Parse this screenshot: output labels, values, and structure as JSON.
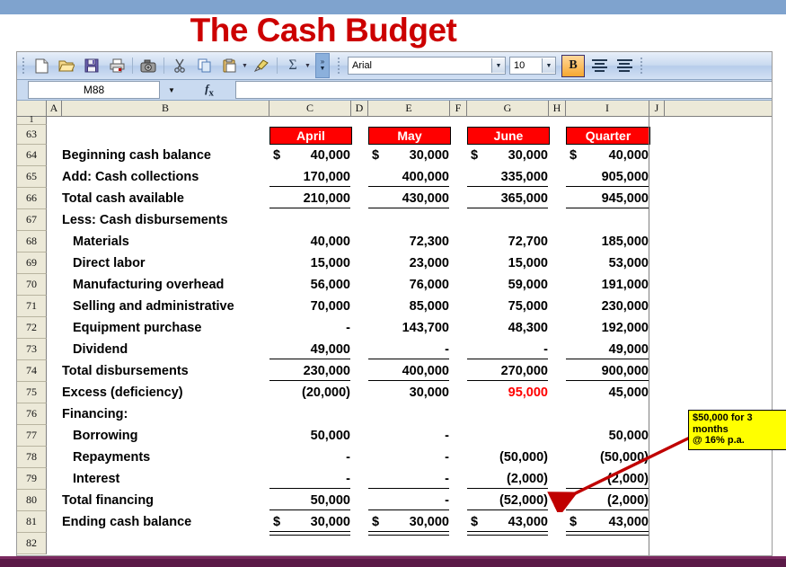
{
  "slide": {
    "title": "The Cash Budget",
    "title_color": "#CC0000",
    "band_color": "#7FA3CE",
    "footer_color": "#5B1A47"
  },
  "toolbar": {
    "icons": [
      {
        "name": "new-document-icon",
        "glyph": "⬜"
      },
      {
        "name": "open-folder-icon",
        "glyph": "📂"
      },
      {
        "name": "save-icon",
        "glyph": "💾"
      },
      {
        "name": "print-icon",
        "glyph": "🖨"
      },
      {
        "name": "camera-icon",
        "glyph": "📷"
      },
      {
        "name": "cut-icon",
        "glyph": "✂"
      },
      {
        "name": "copy-icon",
        "glyph": "⧉"
      },
      {
        "name": "paste-icon",
        "glyph": "📋"
      },
      {
        "name": "format-painter-icon",
        "glyph": "🖌"
      },
      {
        "name": "autosum-icon",
        "glyph": "Σ"
      }
    ],
    "font_name": "Arial",
    "font_size": "10",
    "bold_label": "B",
    "more_buttons_label": "»"
  },
  "formula_bar": {
    "name_box": "M88",
    "formula": ""
  },
  "sheet": {
    "columns": [
      "A",
      "B",
      "C",
      "D",
      "E",
      "F",
      "G",
      "H",
      "I",
      "J"
    ],
    "partial_top_row": "1",
    "header_row_number": "63",
    "period_headers": [
      "April",
      "May",
      "June",
      "Quarter"
    ],
    "rows": [
      {
        "n": "64",
        "label": "Beginning cash balance",
        "indent": 0,
        "dollar": true,
        "values": [
          "40,000",
          "30,000",
          "30,000",
          "40,000"
        ],
        "rule": "none"
      },
      {
        "n": "65",
        "label": "Add: Cash collections",
        "indent": 0,
        "dollar": false,
        "values": [
          "170,000",
          "400,000",
          "335,000",
          "905,000"
        ],
        "rule": "single"
      },
      {
        "n": "66",
        "label": "Total cash available",
        "indent": 0,
        "dollar": false,
        "values": [
          "210,000",
          "430,000",
          "365,000",
          "945,000"
        ],
        "rule": "single"
      },
      {
        "n": "67",
        "label": "Less: Cash disbursements",
        "indent": 0,
        "dollar": false,
        "values": [
          "",
          "",
          "",
          ""
        ],
        "rule": "none"
      },
      {
        "n": "68",
        "label": "Materials",
        "indent": 1,
        "dollar": false,
        "values": [
          "40,000",
          "72,300",
          "72,700",
          "185,000"
        ],
        "rule": "none"
      },
      {
        "n": "69",
        "label": "Direct labor",
        "indent": 1,
        "dollar": false,
        "values": [
          "15,000",
          "23,000",
          "15,000",
          "53,000"
        ],
        "rule": "none"
      },
      {
        "n": "70",
        "label": "Manufacturing overhead",
        "indent": 1,
        "dollar": false,
        "values": [
          "56,000",
          "76,000",
          "59,000",
          "191,000"
        ],
        "rule": "none"
      },
      {
        "n": "71",
        "label": "Selling and administrative",
        "indent": 1,
        "dollar": false,
        "values": [
          "70,000",
          "85,000",
          "75,000",
          "230,000"
        ],
        "rule": "none"
      },
      {
        "n": "72",
        "label": "Equipment purchase",
        "indent": 1,
        "dollar": false,
        "values": [
          "-",
          "143,700",
          "48,300",
          "192,000"
        ],
        "rule": "none"
      },
      {
        "n": "73",
        "label": "Dividend",
        "indent": 1,
        "dollar": false,
        "values": [
          "49,000",
          "-",
          "-",
          "49,000"
        ],
        "rule": "single"
      },
      {
        "n": "74",
        "label": "Total disbursements",
        "indent": 0,
        "dollar": false,
        "values": [
          "230,000",
          "400,000",
          "270,000",
          "900,000"
        ],
        "rule": "single"
      },
      {
        "n": "75",
        "label": "Excess (deficiency)",
        "indent": 0,
        "dollar": false,
        "values": [
          "(20,000)",
          "30,000",
          "95,000",
          "45,000"
        ],
        "rule": "none",
        "red_cols": [
          2
        ]
      },
      {
        "n": "76",
        "label": "Financing:",
        "indent": 0,
        "dollar": false,
        "values": [
          "",
          "",
          "",
          ""
        ],
        "rule": "none"
      },
      {
        "n": "77",
        "label": "Borrowing",
        "indent": 1,
        "dollar": false,
        "values": [
          "50,000",
          "-",
          "",
          "50,000"
        ],
        "rule": "none"
      },
      {
        "n": "78",
        "label": "Repayments",
        "indent": 1,
        "dollar": false,
        "values": [
          "-",
          "-",
          "(50,000)",
          "(50,000)"
        ],
        "rule": "none"
      },
      {
        "n": "79",
        "label": "Interest",
        "indent": 1,
        "dollar": false,
        "values": [
          "-",
          "-",
          "(2,000)",
          "(2,000)"
        ],
        "rule": "single"
      },
      {
        "n": "80",
        "label": "Total financing",
        "indent": 0,
        "dollar": false,
        "values": [
          "50,000",
          "-",
          "(52,000)",
          "(2,000)"
        ],
        "rule": "single"
      },
      {
        "n": "81",
        "label": "Ending cash balance",
        "indent": 0,
        "dollar": true,
        "values": [
          "30,000",
          "30,000",
          "43,000",
          "43,000"
        ],
        "rule": "double"
      },
      {
        "n": "82",
        "label": "",
        "indent": 0,
        "dollar": false,
        "values": [
          "",
          "",
          "",
          ""
        ],
        "rule": "none"
      }
    ]
  },
  "callout": {
    "line1": "$50,000 for 3",
    "line2": "months",
    "line3": "@ 16% p.a.",
    "bg": "#FFFF00",
    "arrow_color": "#C00000"
  }
}
